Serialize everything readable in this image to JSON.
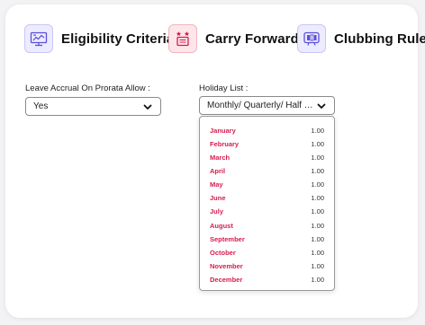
{
  "tabs": [
    {
      "label": "Eligibility Criteria",
      "icon": "eligibility-icon"
    },
    {
      "label": "Carry Forward",
      "icon": "carry-forward-icon"
    },
    {
      "label": "Clubbing Rule",
      "icon": "clubbing-rule-icon"
    }
  ],
  "leave_accrual": {
    "label": "Leave Accrual On Prorata Allow :",
    "value": "Yes"
  },
  "holiday_list": {
    "label": "Holiday List :",
    "value": "Monthly/ Quarterly/ Half Ye..."
  },
  "months": [
    {
      "month": "January",
      "value": "1.00"
    },
    {
      "month": "February",
      "value": "1.00"
    },
    {
      "month": "March",
      "value": "1.00"
    },
    {
      "month": "April",
      "value": "1.00"
    },
    {
      "month": "May",
      "value": "1.00"
    },
    {
      "month": "June",
      "value": "1.00"
    },
    {
      "month": "July",
      "value": "1.00"
    },
    {
      "month": "August",
      "value": "1.00"
    },
    {
      "month": "September",
      "value": "1.00"
    },
    {
      "month": "October",
      "value": "1.00"
    },
    {
      "month": "November",
      "value": "1.00"
    },
    {
      "month": "December",
      "value": "1.00"
    }
  ],
  "colors": {
    "accent_purple": "#5b4fd6",
    "accent_red": "#d61c4e"
  }
}
